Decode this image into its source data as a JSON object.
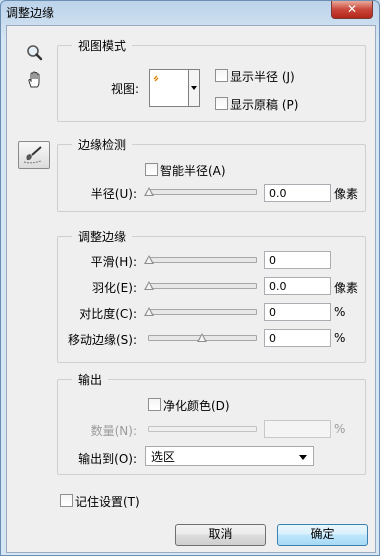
{
  "window": {
    "title": "调整边缘",
    "close_label": "✕"
  },
  "tools": {
    "zoom_icon": "magnifier",
    "hand_icon": "hand",
    "refine_radius_icon": "brush"
  },
  "view_mode": {
    "legend": "视图模式",
    "view_label": "视图:",
    "show_radius": "显示半径 (J)",
    "show_original": "显示原稿 (P)"
  },
  "edge_detection": {
    "legend": "边缘检测",
    "smart_radius": "智能半径(A)",
    "radius_label": "半径(U):",
    "radius_value": "0.0",
    "radius_unit": "像素"
  },
  "adjust_edge": {
    "legend": "调整边缘",
    "smooth_label": "平滑(H):",
    "smooth_value": "0",
    "feather_label": "羽化(E):",
    "feather_value": "0.0",
    "feather_unit": "像素",
    "contrast_label": "对比度(C):",
    "contrast_value": "0",
    "contrast_unit": "%",
    "shift_label": "移动边缘(S):",
    "shift_value": "0",
    "shift_unit": "%"
  },
  "output": {
    "legend": "输出",
    "decontaminate": "净化颜色(D)",
    "amount_label": "数量(N):",
    "amount_unit": "%",
    "output_to_label": "输出到(O):",
    "output_to_value": "选区"
  },
  "remember": "记住设置(T)",
  "buttons": {
    "cancel": "取消",
    "ok": "确定"
  }
}
